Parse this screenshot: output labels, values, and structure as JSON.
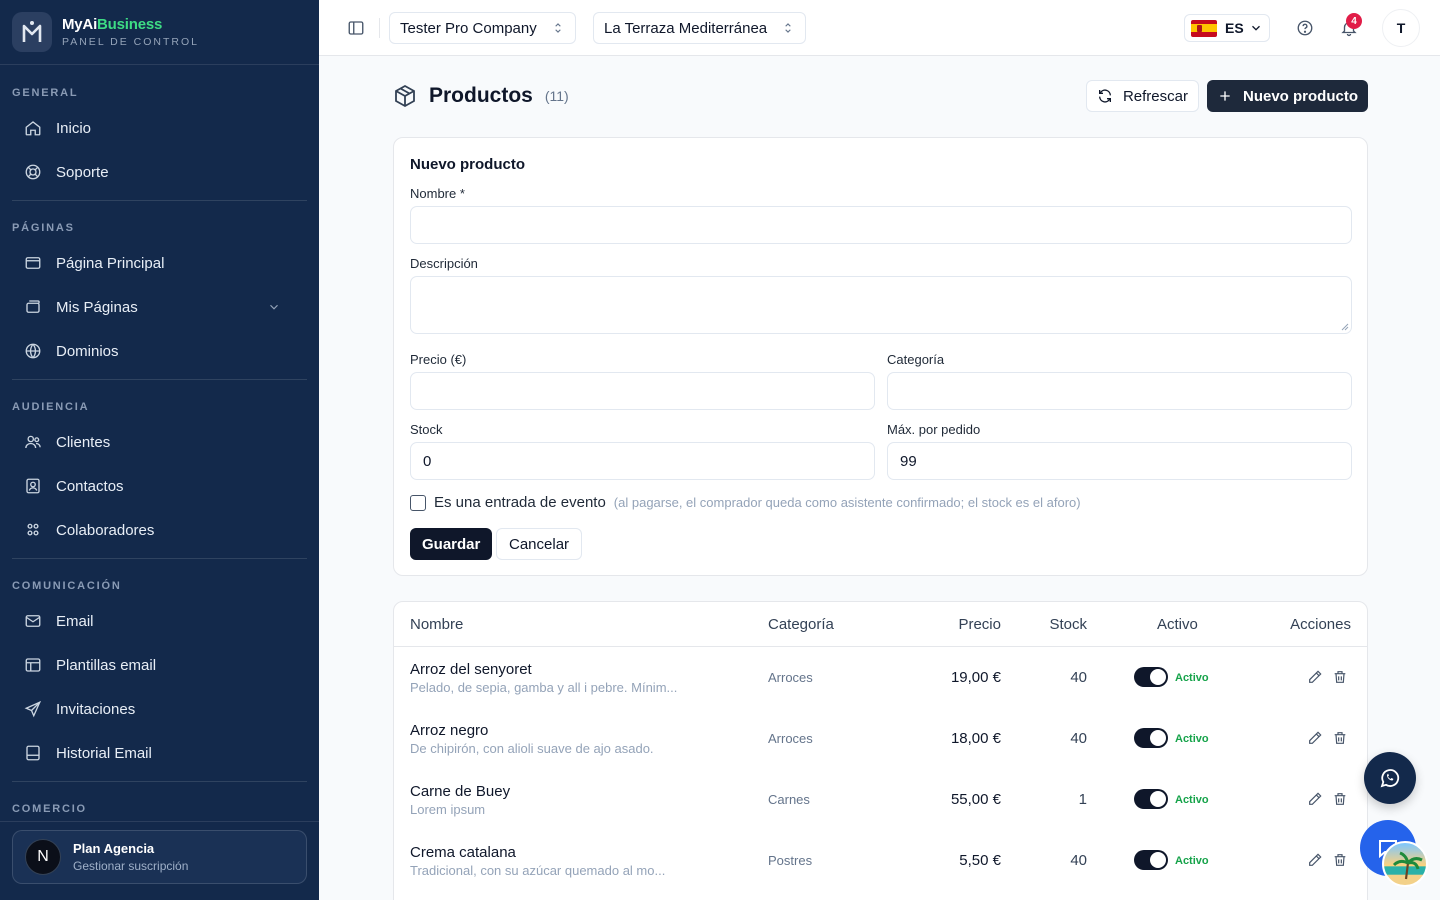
{
  "brand": {
    "name_part1": "MyAi",
    "name_part2": "Business",
    "subtitle": "PANEL DE CONTROL"
  },
  "sidebar": {
    "sections": [
      {
        "label": "GENERAL",
        "items": [
          {
            "label": "Inicio",
            "icon": "home-icon"
          },
          {
            "label": "Soporte",
            "icon": "lifebuoy-icon"
          }
        ]
      },
      {
        "label": "PÁGINAS",
        "items": [
          {
            "label": "Página Principal",
            "icon": "browser-icon"
          },
          {
            "label": "Mis Páginas",
            "icon": "pages-icon",
            "expandable": true
          },
          {
            "label": "Dominios",
            "icon": "globe-icon"
          }
        ]
      },
      {
        "label": "AUDIENCIA",
        "items": [
          {
            "label": "Clientes",
            "icon": "users-icon"
          },
          {
            "label": "Contactos",
            "icon": "contact-icon"
          },
          {
            "label": "Colaboradores",
            "icon": "team-icon"
          }
        ]
      },
      {
        "label": "COMUNICACIÓN",
        "items": [
          {
            "label": "Email",
            "icon": "mail-icon"
          },
          {
            "label": "Plantillas email",
            "icon": "template-icon"
          },
          {
            "label": "Invitaciones",
            "icon": "send-icon"
          },
          {
            "label": "Historial Email",
            "icon": "inbox-icon"
          }
        ]
      },
      {
        "label": "COMERCIO",
        "items": []
      }
    ],
    "plan": {
      "avatar": "N",
      "title": "Plan Agencia",
      "subtitle": "Gestionar suscripción"
    }
  },
  "topbar": {
    "company": "Tester Pro Company",
    "site": "La Terraza Mediterránea",
    "language": "ES",
    "notifications": "4",
    "user_initial": "T"
  },
  "header": {
    "title": "Productos",
    "count": "(11)",
    "refresh_label": "Refrescar",
    "new_label": "Nuevo producto"
  },
  "form": {
    "title": "Nuevo producto",
    "name_label": "Nombre *",
    "name_value": "",
    "description_label": "Descripción",
    "description_value": "",
    "price_label": "Precio (€)",
    "price_value": "",
    "category_label": "Categoría",
    "category_value": "",
    "stock_label": "Stock",
    "stock_value": "0",
    "max_label": "Máx. por pedido",
    "max_value": "99",
    "event_label": "Es una entrada de evento",
    "event_hint": "(al pagarse, el comprador queda como asistente confirmado; el stock es el aforo)",
    "save_label": "Guardar",
    "cancel_label": "Cancelar"
  },
  "table": {
    "headers": {
      "name": "Nombre",
      "category": "Categoría",
      "price": "Precio",
      "stock": "Stock",
      "active": "Activo",
      "actions": "Acciones"
    },
    "rows": [
      {
        "name": "Arroz del senyoret",
        "description": "Pelado, de sepia, gamba y all i pebre. Mínim...",
        "category": "Arroces",
        "price": "19,00 €",
        "stock": "40",
        "status": "Activo"
      },
      {
        "name": "Arroz negro",
        "description": "De chipirón, con alioli suave de ajo asado.",
        "category": "Arroces",
        "price": "18,00 €",
        "stock": "40",
        "status": "Activo"
      },
      {
        "name": "Carne de Buey",
        "description": "Lorem ipsum",
        "category": "Carnes",
        "price": "55,00 €",
        "stock": "1",
        "status": "Activo"
      },
      {
        "name": "Crema catalana",
        "description": "Tradicional, con su azúcar quemado al mo...",
        "category": "Postres",
        "price": "5,50 €",
        "stock": "40",
        "status": "Activo"
      }
    ]
  },
  "colors": {
    "sidebar_bg": "#13294b",
    "accent_green": "#3ddc84",
    "primary_dark": "#0f172a",
    "badge_red": "#e11d48",
    "active_green": "#16a34a"
  }
}
